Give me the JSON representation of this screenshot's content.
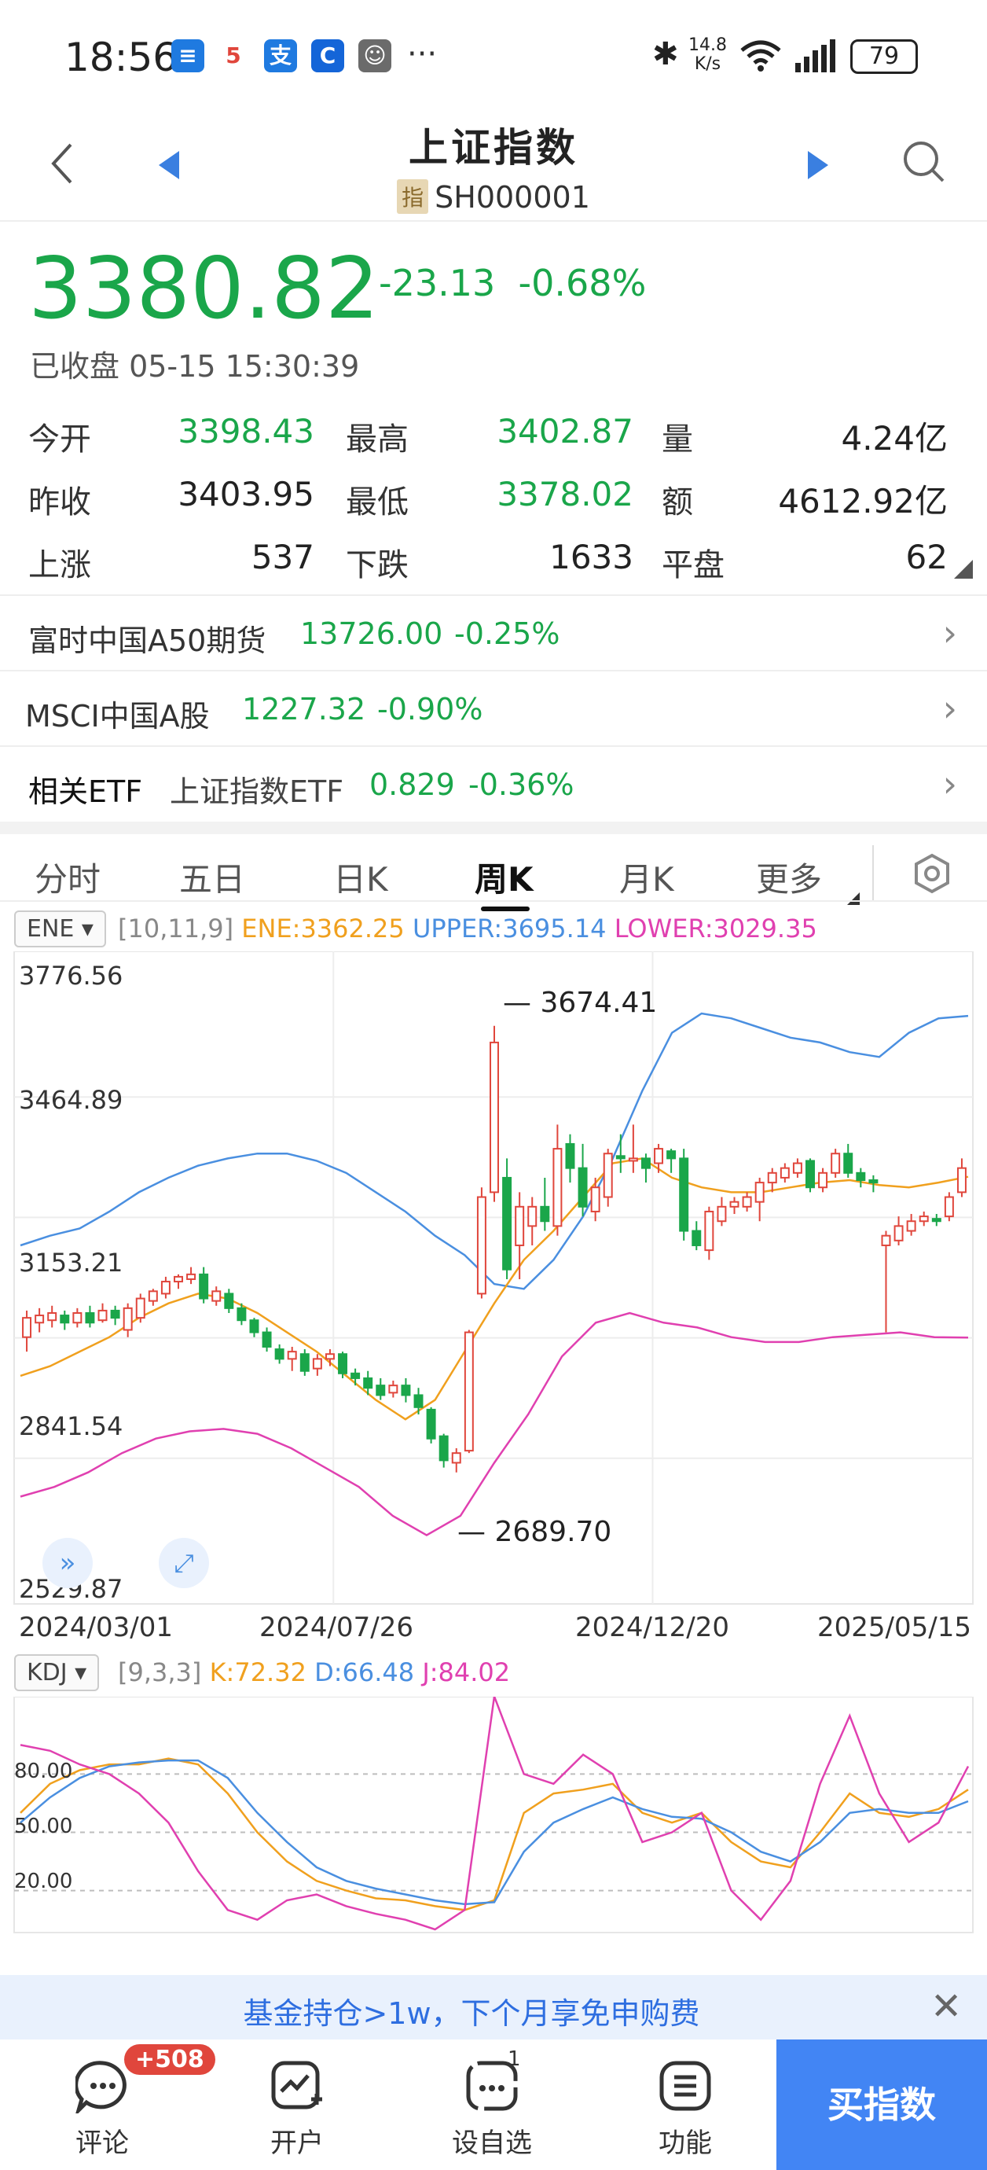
{
  "status_bar": {
    "time": "18:56",
    "net_speed": "14.8\nK/s",
    "net_speed_top": "14.8",
    "net_speed_bottom": "K/s",
    "battery": "79",
    "more": "···"
  },
  "header": {
    "title": "上证指数",
    "code_tag": "指",
    "code": "SH000001"
  },
  "quote": {
    "price": "3380.82",
    "change": "-23.13",
    "change_pct": "-0.68%",
    "status": "已收盘 05-15 15:30:39"
  },
  "stats": [
    {
      "label": "今开",
      "value": "3398.43",
      "color": "green"
    },
    {
      "label": "最高",
      "value": "3402.87",
      "color": "green"
    },
    {
      "label": "量",
      "value": "4.24亿",
      "color": "black"
    },
    {
      "label": "昨收",
      "value": "3403.95",
      "color": "black"
    },
    {
      "label": "最低",
      "value": "3378.02",
      "color": "green"
    },
    {
      "label": "额",
      "value": "4612.92亿",
      "color": "black"
    },
    {
      "label": "上涨",
      "value": "537",
      "color": "black"
    },
    {
      "label": "下跌",
      "value": "1633",
      "color": "black"
    },
    {
      "label": "平盘",
      "value": "62",
      "color": "black"
    }
  ],
  "related": [
    {
      "name": "富时中国A50期货",
      "value": "13726.00",
      "pct": "-0.25%"
    },
    {
      "name": "MSCI中国A股",
      "value": "1227.32",
      "pct": "-0.90%"
    },
    {
      "name": "相关ETF",
      "sub": "上证指数ETF",
      "value": "0.829",
      "pct": "-0.36%"
    }
  ],
  "tabs": [
    "分时",
    "五日",
    "日K",
    "周K",
    "月K",
    "更多"
  ],
  "active_tab": "周K",
  "indicator": {
    "name": "ENE",
    "params": "[10,11,9]",
    "ene": "ENE:3362.25",
    "upper": "UPPER:3695.14",
    "lower": "LOWER:3029.35"
  },
  "kdj": {
    "name": "KDJ",
    "params": "[9,3,3]",
    "k": "K:72.32",
    "d": "D:66.48",
    "j": "J:84.02"
  },
  "colors": {
    "up": "#e0463c",
    "down": "#1aa64a",
    "ene": "#f0a01e",
    "upper": "#4a8fe0",
    "lower": "#e040b0",
    "accent": "#4285f4"
  },
  "chart_data": [
    {
      "type": "candlestick",
      "title": "",
      "y_ticks": [
        "3776.56",
        "3464.89",
        "3153.21",
        "2841.54",
        "2529.87"
      ],
      "ylim": [
        2529.87,
        3776.56
      ],
      "x_ticks": [
        "2024/03/01",
        "2024/07/26",
        "2024/12/20",
        "2025/05/15"
      ],
      "annotations": [
        "3674.41",
        "2689.70"
      ],
      "candles": [
        [
          3030,
          3070,
          3000,
          3085
        ],
        [
          3060,
          3075,
          3040,
          3090
        ],
        [
          3065,
          3080,
          3050,
          3095
        ],
        [
          3075,
          3060,
          3045,
          3085
        ],
        [
          3060,
          3080,
          3050,
          3090
        ],
        [
          3080,
          3060,
          3050,
          3095
        ],
        [
          3065,
          3085,
          3060,
          3100
        ],
        [
          3085,
          3070,
          3055,
          3095
        ],
        [
          3045,
          3090,
          3030,
          3100
        ],
        [
          3070,
          3110,
          3060,
          3120
        ],
        [
          3105,
          3125,
          3095,
          3130
        ],
        [
          3120,
          3145,
          3110,
          3155
        ],
        [
          3145,
          3155,
          3130,
          3160
        ],
        [
          3150,
          3160,
          3140,
          3175
        ],
        [
          3160,
          3110,
          3100,
          3175
        ],
        [
          3105,
          3125,
          3095,
          3135
        ],
        [
          3120,
          3090,
          3080,
          3130
        ],
        [
          3090,
          3065,
          3055,
          3100
        ],
        [
          3065,
          3040,
          3030,
          3070
        ],
        [
          3040,
          3010,
          3000,
          3050
        ],
        [
          3005,
          2985,
          2975,
          3015
        ],
        [
          2985,
          3000,
          2960,
          3010
        ],
        [
          2995,
          2960,
          2950,
          3005
        ],
        [
          2965,
          2985,
          2950,
          2995
        ],
        [
          2985,
          2995,
          2970,
          3005
        ],
        [
          2995,
          2955,
          2945,
          3000
        ],
        [
          2955,
          2945,
          2930,
          2965
        ],
        [
          2945,
          2925,
          2910,
          2960
        ],
        [
          2930,
          2910,
          2900,
          2945
        ],
        [
          2915,
          2930,
          2905,
          2940
        ],
        [
          2930,
          2910,
          2895,
          2945
        ],
        [
          2910,
          2885,
          2870,
          2925
        ],
        [
          2880,
          2820,
          2810,
          2885
        ],
        [
          2825,
          2775,
          2760,
          2830
        ],
        [
          2770,
          2790,
          2750,
          2800
        ],
        [
          2795,
          3040,
          2790,
          3045
        ],
        [
          3120,
          3320,
          3110,
          3340
        ],
        [
          3330,
          3640,
          3310,
          3674.41
        ],
        [
          3360,
          3170,
          3150,
          3400
        ],
        [
          3220,
          3300,
          3150,
          3330
        ],
        [
          3260,
          3300,
          3220,
          3320
        ],
        [
          3300,
          3270,
          3250,
          3360
        ],
        [
          3260,
          3420,
          3240,
          3470
        ],
        [
          3430,
          3380,
          3350,
          3450
        ],
        [
          3380,
          3300,
          3280,
          3430
        ],
        [
          3290,
          3340,
          3270,
          3360
        ],
        [
          3320,
          3410,
          3300,
          3420
        ],
        [
          3405,
          3400,
          3370,
          3450
        ],
        [
          3395,
          3400,
          3370,
          3470
        ],
        [
          3400,
          3380,
          3350,
          3410
        ],
        [
          3390,
          3420,
          3370,
          3430
        ],
        [
          3415,
          3400,
          3370,
          3420
        ],
        [
          3400,
          3250,
          3230,
          3420
        ],
        [
          3250,
          3220,
          3210,
          3270
        ],
        [
          3210,
          3290,
          3190,
          3300
        ],
        [
          3270,
          3300,
          3260,
          3320
        ],
        [
          3300,
          3310,
          3285,
          3320
        ],
        [
          3300,
          3320,
          3290,
          3330
        ],
        [
          3310,
          3350,
          3270,
          3360
        ],
        [
          3350,
          3370,
          3330,
          3380
        ],
        [
          3360,
          3380,
          3350,
          3390
        ],
        [
          3370,
          3390,
          3360,
          3400
        ],
        [
          3395,
          3340,
          3330,
          3400
        ],
        [
          3340,
          3370,
          3330,
          3380
        ],
        [
          3370,
          3410,
          3360,
          3420
        ],
        [
          3410,
          3370,
          3360,
          3430
        ],
        [
          3370,
          3355,
          3340,
          3380
        ],
        [
          3355,
          3350,
          3330,
          3365
        ],
        [
          3220,
          3240,
          3040,
          3250
        ],
        [
          3230,
          3260,
          3220,
          3280
        ],
        [
          3250,
          3270,
          3240,
          3285
        ],
        [
          3270,
          3280,
          3260,
          3290
        ],
        [
          3275,
          3270,
          3260,
          3285
        ],
        [
          3280,
          3320,
          3270,
          3330
        ],
        [
          3330,
          3380,
          3320,
          3400
        ]
      ],
      "series": [
        {
          "name": "UPPER",
          "values": [
            3220,
            3240,
            3255,
            3290,
            3330,
            3360,
            3385,
            3400,
            3410,
            3410,
            3395,
            3370,
            3330,
            3290,
            3240,
            3200,
            3140,
            3130,
            3190,
            3280,
            3400,
            3540,
            3660,
            3700,
            3690,
            3670,
            3650,
            3640,
            3620,
            3610,
            3660,
            3690,
            3695
          ]
        },
        {
          "name": "ENE",
          "values": [
            2950,
            2970,
            3000,
            3030,
            3070,
            3100,
            3120,
            3110,
            3080,
            3040,
            3000,
            2950,
            2900,
            2860,
            2900,
            3000,
            3100,
            3190,
            3250,
            3320,
            3390,
            3400,
            3360,
            3340,
            3330,
            3330,
            3340,
            3350,
            3355,
            3345,
            3340,
            3350,
            3362
          ]
        },
        {
          "name": "LOWER",
          "values": [
            2700,
            2720,
            2750,
            2790,
            2820,
            2835,
            2840,
            2830,
            2800,
            2760,
            2720,
            2660,
            2620,
            2660,
            2770,
            2870,
            2990,
            3060,
            3080,
            3060,
            3050,
            3030,
            3020,
            3020,
            3030,
            3035,
            3040,
            3030,
            3029
          ]
        }
      ]
    },
    {
      "type": "line",
      "title": "",
      "y_ticks": [
        "80.00",
        "50.00",
        "20.00"
      ],
      "series": [
        {
          "name": "K",
          "values": [
            60,
            75,
            82,
            85,
            85,
            88,
            85,
            70,
            50,
            35,
            25,
            20,
            16,
            15,
            12,
            10,
            15,
            60,
            70,
            72,
            75,
            60,
            55,
            60,
            45,
            35,
            32,
            50,
            70,
            60,
            58,
            62,
            72
          ]
        },
        {
          "name": "D",
          "values": [
            55,
            68,
            78,
            84,
            86,
            87,
            87,
            78,
            60,
            45,
            32,
            25,
            21,
            18,
            15,
            13,
            14,
            40,
            55,
            62,
            68,
            62,
            58,
            57,
            50,
            40,
            35,
            45,
            60,
            62,
            60,
            60,
            66
          ]
        },
        {
          "name": "J",
          "values": [
            95,
            92,
            85,
            80,
            70,
            55,
            30,
            10,
            5,
            15,
            18,
            12,
            8,
            5,
            0,
            10,
            120,
            80,
            75,
            90,
            80,
            45,
            50,
            60,
            20,
            5,
            25,
            75,
            110,
            70,
            45,
            55,
            84
          ]
        }
      ]
    }
  ],
  "bottom_bar": {
    "banner": "基金持仓>1w，下个月享免申购费",
    "comment_label": "评论",
    "comment_badge": "+508",
    "open_label": "开户",
    "watch_label": "设自选",
    "watch_count": "1",
    "func_label": "功能",
    "buy_label": "买指数"
  }
}
